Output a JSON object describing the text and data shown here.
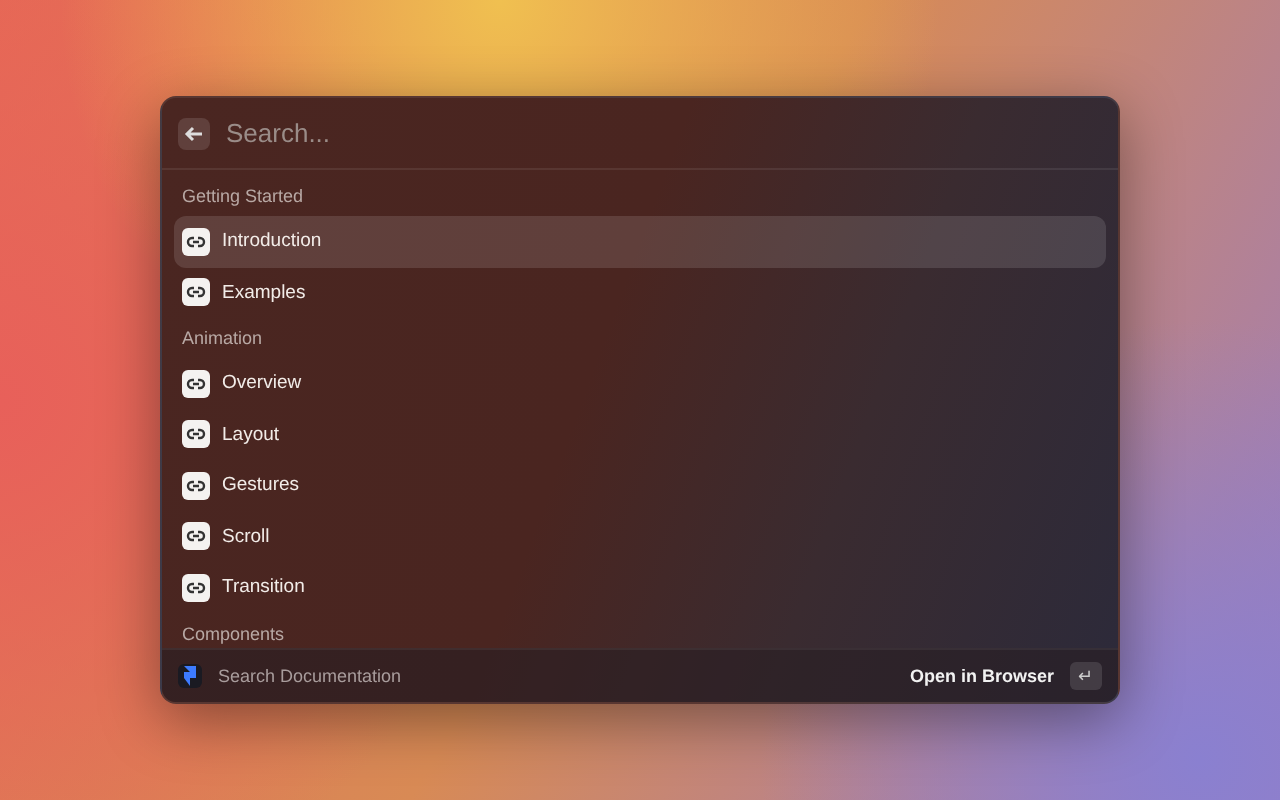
{
  "search": {
    "placeholder": "Search..."
  },
  "sections": [
    {
      "title": "Getting Started",
      "items": [
        {
          "label": "Introduction",
          "selected": true
        },
        {
          "label": "Examples",
          "selected": false
        }
      ]
    },
    {
      "title": "Animation",
      "items": [
        {
          "label": "Overview",
          "selected": false
        },
        {
          "label": "Layout",
          "selected": false
        },
        {
          "label": "Gestures",
          "selected": false
        },
        {
          "label": "Scroll",
          "selected": false
        },
        {
          "label": "Transition",
          "selected": false
        }
      ]
    },
    {
      "title": "Components"
    }
  ],
  "footer": {
    "title": "Search Documentation",
    "action": "Open in Browser",
    "shortcut": "↵"
  }
}
